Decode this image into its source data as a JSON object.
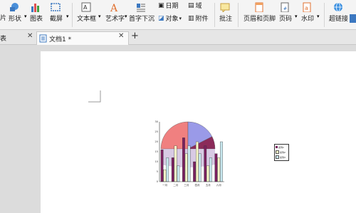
{
  "ribbon": {
    "row1": {
      "item1": "片",
      "shape": "形状",
      "chart": "图表",
      "screenshot": "截屏",
      "textbox": "文本框",
      "wordart": "艺术字",
      "dropcap": "首字下沉",
      "object": "对象",
      "comment": "批注",
      "header_footer": "页眉和页脚",
      "page_number": "页码",
      "watermark": "水印",
      "hyperlink": "超链接",
      "date": "日期",
      "attachment": "附件",
      "field": "域"
    }
  },
  "tabs": [
    {
      "label": "表"
    },
    {
      "label": "文档1 *"
    }
  ],
  "add_tab": "+",
  "chart": {
    "y_ticks": [
      "0",
      "5",
      "10",
      "15",
      "20",
      "25",
      "30"
    ],
    "x_ticks": [
      "一月",
      "二月",
      "三月",
      "四月",
      "五月",
      "六月"
    ],
    "legend": [
      "系列1",
      "系列2",
      "系列3"
    ]
  },
  "chart_data": {
    "type": "bar",
    "categories": [
      "一月",
      "二月",
      "三月",
      "四月",
      "五月",
      "六月"
    ],
    "series": [
      {
        "name": "系列1",
        "values": [
          16,
          12,
          22,
          10,
          18,
          14
        ]
      },
      {
        "name": "系列2",
        "values": [
          6,
          18,
          14,
          20,
          8,
          12
        ]
      },
      {
        "name": "系列3",
        "values": [
          12,
          8,
          18,
          14,
          12,
          20
        ]
      }
    ],
    "ylim": [
      0,
      30
    ],
    "colors": {
      "pie_a": "#f08080",
      "pie_b": "#9a9ae8",
      "pie_c": "#8b2a5a",
      "bar1": "#7b2060",
      "bar2": "#fafac8",
      "bar3": "#c8e8ef"
    }
  }
}
